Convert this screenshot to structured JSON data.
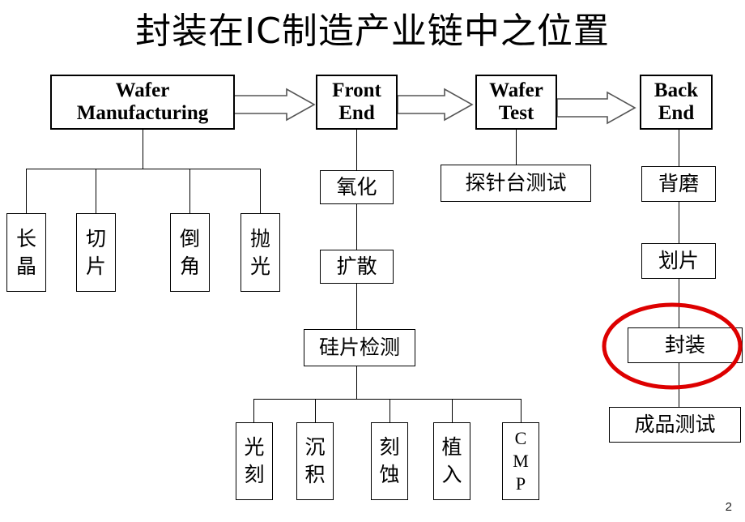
{
  "slide": {
    "title": "封装在IC制造产业链中之位置",
    "page_number": "2",
    "background_color": "#ffffff",
    "line_color": "#000000",
    "highlight_color": "#dd0000"
  },
  "stages": [
    {
      "id": "wafer-manufacturing",
      "line1": "Wafer",
      "line2": "Manufacturing"
    },
    {
      "id": "front-end",
      "line1": "Front",
      "line2": "End"
    },
    {
      "id": "wafer-test",
      "line1": "Wafer",
      "line2": "Test"
    },
    {
      "id": "back-end",
      "line1": "Back",
      "line2": "End"
    }
  ],
  "wafer_manufacturing_steps": [
    {
      "id": "crystal-growth",
      "char1": "长",
      "char2": "晶"
    },
    {
      "id": "slicing",
      "char1": "切",
      "char2": "片"
    },
    {
      "id": "edge-rounding",
      "char1": "倒",
      "char2": "角"
    },
    {
      "id": "polishing",
      "char1": "抛",
      "char2": "光"
    }
  ],
  "front_end_steps": [
    {
      "id": "oxidation",
      "label": "氧化"
    },
    {
      "id": "diffusion",
      "label": "扩散"
    },
    {
      "id": "wafer-inspection",
      "label": "硅片检测"
    }
  ],
  "front_end_substeps": [
    {
      "id": "photolithography",
      "char1": "光",
      "char2": "刻"
    },
    {
      "id": "deposition",
      "char1": "沉",
      "char2": "积"
    },
    {
      "id": "etching",
      "char1": "刻",
      "char2": "蚀"
    },
    {
      "id": "implantation",
      "char1": "植",
      "char2": "入"
    },
    {
      "id": "cmp",
      "char1": "C",
      "char2": "M",
      "char3": "P"
    }
  ],
  "wafer_test_steps": [
    {
      "id": "probe-station-test",
      "label": "探针台测试"
    }
  ],
  "back_end_steps": [
    {
      "id": "backgrinding",
      "label": "背磨"
    },
    {
      "id": "dicing",
      "label": "划片"
    },
    {
      "id": "packaging",
      "label": "封装",
      "highlighted": true
    },
    {
      "id": "final-test",
      "label": "成品测试"
    }
  ]
}
